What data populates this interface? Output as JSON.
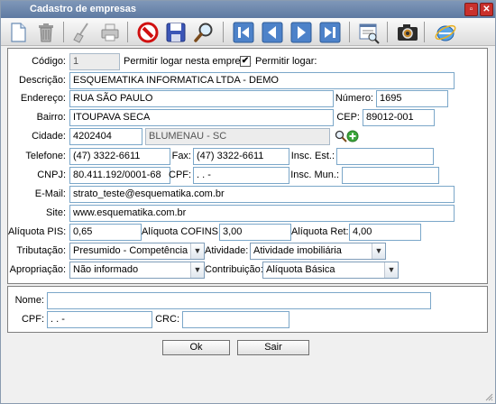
{
  "window": {
    "title": "Cadastro de empresas"
  },
  "toolbar": {
    "icons": [
      "new-document-icon",
      "trash-icon",
      "broom-icon",
      "printer-icon",
      "cancel-icon",
      "save-icon",
      "search-icon",
      "first-record-icon",
      "previous-record-icon",
      "next-record-icon",
      "last-record-icon",
      "report-icon",
      "camera-icon",
      "ie-browser-icon"
    ]
  },
  "form": {
    "codigo_label": "Código:",
    "codigo_value": "1",
    "permitir_logar_empresa_label": "Permitir logar nesta empresa",
    "permitir_logar_label": "Permitir logar:",
    "permitir_logar_checked": true,
    "descricao_label": "Descrição:",
    "descricao_value": "ESQUEMATIKA INFORMATICA LTDA - DEMO",
    "endereco_label": "Endereço:",
    "endereco_value": "RUA SÃO PAULO",
    "numero_label": "Número:",
    "numero_value": "1695",
    "bairro_label": "Bairro:",
    "bairro_value": "ITOUPAVA SECA",
    "cep_label": "CEP:",
    "cep_value": "89012-001",
    "cidade_label": "Cidade:",
    "cidade_code": "4202404",
    "cidade_name": "BLUMENAU - SC",
    "telefone_label": "Telefone:",
    "telefone_value": "(47) 3322-6611",
    "fax_label": "Fax:",
    "fax_value": "(47) 3322-6611",
    "insc_est_label": "Insc. Est.:",
    "insc_est_value": "",
    "cnpj_label": "CNPJ:",
    "cnpj_value": "80.411.192/0001-68",
    "cpf_label": "CPF:",
    "cpf_value": " .   .   -",
    "insc_mun_label": "Insc. Mun.:",
    "insc_mun_value": "",
    "email_label": "E-Mail:",
    "email_value": "strato_teste@esquematika.com.br",
    "site_label": "Site:",
    "site_value": "www.esquematika.com.br",
    "aliquota_pis_label": "Alíquota PIS:",
    "aliquota_pis_value": "0,65",
    "aliquota_cofins_label": "Alíquota COFINS:",
    "aliquota_cofins_value": "3,00",
    "aliquota_ret_label": "Alíquota Ret:",
    "aliquota_ret_value": "4,00",
    "tributacao_label": "Tributação:",
    "tributacao_value": "Presumido - Competência",
    "atividade_label": "Atividade:",
    "atividade_value": "Atividade imobiliária",
    "apropriacao_label": "Apropriação:",
    "apropriacao_value": "Não informado",
    "contribuicao_label": "Contribuição:",
    "contribuicao_value": "Alíquota Básica"
  },
  "contador": {
    "nome_label": "Nome:",
    "nome_value": "",
    "cpf_label": "CPF:",
    "cpf_value": " .   .   -",
    "crc_label": "CRC:",
    "crc_value": ""
  },
  "buttons": {
    "ok_label": "Ok",
    "sair_label": "Sair"
  },
  "colors": {
    "titlebar": "#6b86ab",
    "field_border": "#7ba7c9",
    "close_button": "#c9302c"
  }
}
